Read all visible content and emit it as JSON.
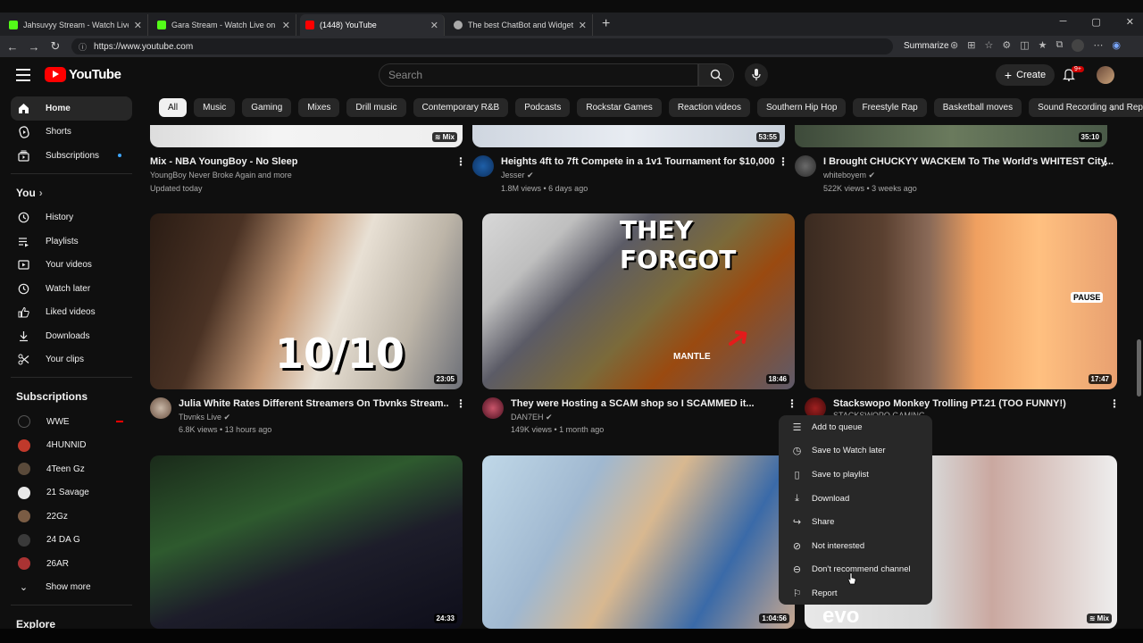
{
  "browser": {
    "tabs": [
      {
        "title": "Jahsuvyy Stream - Watch Live on",
        "favcolor": "#53fc18"
      },
      {
        "title": "Gara Stream - Watch Live on Kick",
        "favcolor": "#53fc18"
      },
      {
        "title": "(1448) YouTube",
        "favcolor": "#ff0000"
      },
      {
        "title": "The best ChatBot and Widgets fo",
        "favcolor": "#aaaaaa"
      }
    ],
    "url": "https://www.youtube.com",
    "summarize": "Summarize"
  },
  "header": {
    "logo_text": "YouTube",
    "search_placeholder": "Search",
    "create_label": "Create",
    "notif_badge": "9+"
  },
  "chips": [
    "All",
    "Music",
    "Gaming",
    "Mixes",
    "Drill music",
    "Contemporary R&B",
    "Podcasts",
    "Rockstar Games",
    "Reaction videos",
    "Southern Hip Hop",
    "Freestyle Rap",
    "Basketball moves",
    "Sound Recording and Reproduction"
  ],
  "sidebar": {
    "main": [
      {
        "label": "Home",
        "icon": "home-icon"
      },
      {
        "label": "Shorts",
        "icon": "shorts-icon"
      },
      {
        "label": "Subscriptions",
        "icon": "subscriptions-icon"
      }
    ],
    "you_label": "You",
    "you_items": [
      {
        "label": "History",
        "icon": "history-icon"
      },
      {
        "label": "Playlists",
        "icon": "playlists-icon"
      },
      {
        "label": "Your videos",
        "icon": "your-videos-icon"
      },
      {
        "label": "Watch later",
        "icon": "watch-later-icon"
      },
      {
        "label": "Liked videos",
        "icon": "liked-icon"
      },
      {
        "label": "Downloads",
        "icon": "downloads-icon"
      },
      {
        "label": "Your clips",
        "icon": "clips-icon"
      }
    ],
    "subs_label": "Subscriptions",
    "subs": [
      {
        "label": "WWE",
        "color": "#111111",
        "live": true
      },
      {
        "label": "4HUNNID",
        "color": "#c0392b"
      },
      {
        "label": "4Teen Gz",
        "color": "#5a4a3a"
      },
      {
        "label": "21 Savage",
        "color": "#e8e8e8"
      },
      {
        "label": "22Gz",
        "color": "#7a5c44"
      },
      {
        "label": "24 DA G",
        "color": "#3a3a3a"
      },
      {
        "label": "26AR",
        "color": "#a33"
      }
    ],
    "show_more": "Show more",
    "explore": "Explore"
  },
  "videos_row1": [
    {
      "title": "Mix - NBA YoungBoy - No Sleep",
      "channel": "YoungBoy Never Broke Again and more",
      "meta": "Updated today",
      "badge": "Mix"
    },
    {
      "title": "Heights 4ft to 7ft Compete in a 1v1 Tournament for $10,000",
      "channel": "Jesser",
      "meta": "1.8M views • 6 days ago",
      "duration": "53:55"
    },
    {
      "title": "I Brought CHUCKYY WACKEM To The World's WHITEST City...",
      "channel": "whiteboyem",
      "meta": "522K views • 3 weeks ago",
      "duration": "35:10"
    }
  ],
  "videos_row2": [
    {
      "title": "Julia White Rates Different Streamers On Tbvnks Stream..",
      "channel": "Tbvnks Live",
      "meta": "6.8K views • 13 hours ago",
      "duration": "23:05",
      "overlay": "10/10"
    },
    {
      "title": "They were Hosting a SCAM shop so I SCAMMED it...",
      "channel": "DAN7EH",
      "meta": "149K views • 1 month ago",
      "duration": "18:46",
      "overlay": "THEY FORGOT",
      "overlay2": "MANTLE"
    },
    {
      "title": "Stackswopo Monkey Trolling PT.21 (TOO FUNNY!)",
      "channel": "STACKSWOPO GAMING",
      "meta": "",
      "duration": "17:47",
      "overlay": "PAUSE"
    }
  ],
  "videos_row3": [
    {
      "duration": "24:33"
    },
    {
      "duration": "1:04:56"
    },
    {
      "badge": "Mix",
      "overlay": "evo"
    }
  ],
  "context_menu": [
    {
      "label": "Add to queue",
      "icon": "queue-icon"
    },
    {
      "label": "Save to Watch later",
      "icon": "clock-icon"
    },
    {
      "label": "Save to playlist",
      "icon": "bookmark-icon"
    },
    {
      "label": "Download",
      "icon": "download-icon"
    },
    {
      "label": "Share",
      "icon": "share-icon"
    },
    {
      "label": "Not interested",
      "icon": "block-icon"
    },
    {
      "label": "Don't recommend channel",
      "icon": "minus-circle-icon"
    },
    {
      "label": "Report",
      "icon": "flag-icon"
    }
  ]
}
